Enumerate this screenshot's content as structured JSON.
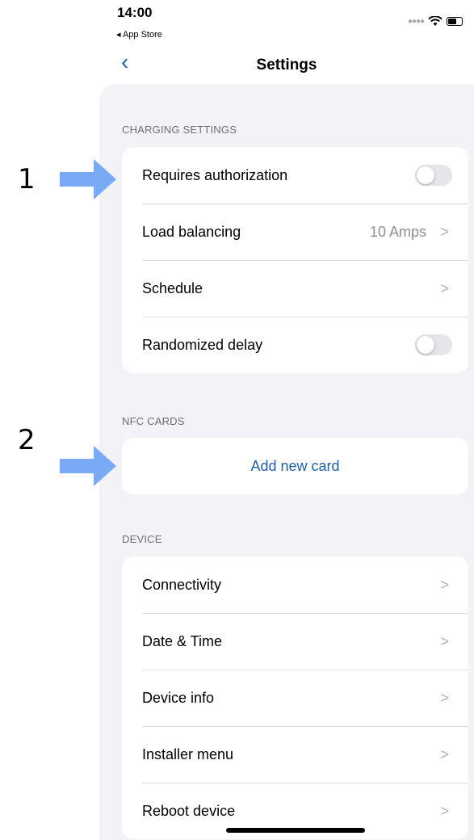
{
  "status_bar": {
    "time": "14:00",
    "back_label": "◂ App Store"
  },
  "nav": {
    "back_icon": "chevron-left-icon",
    "title": "Settings"
  },
  "sections": {
    "charging": {
      "label": "CHARGING SETTINGS",
      "rows": [
        {
          "label": "Requires authorization",
          "toggle_on": false
        },
        {
          "label": "Load balancing",
          "value": "10 Amps"
        },
        {
          "label": "Schedule"
        },
        {
          "label": "Randomized delay",
          "toggle_on": false
        }
      ]
    },
    "nfc": {
      "label": "NFC CARDS",
      "add_card_label": "Add new card"
    },
    "device": {
      "label": "DEVICE",
      "rows": [
        {
          "label": "Connectivity"
        },
        {
          "label": "Date & Time"
        },
        {
          "label": "Device info"
        },
        {
          "label": "Installer menu"
        },
        {
          "label": "Reboot device"
        }
      ]
    }
  },
  "annotations": {
    "callout_1": "1",
    "callout_2": "2",
    "arrow_color": "#7aaaf5"
  },
  "colors": {
    "accent": "#1f5fa8",
    "background": "#f2f2f7"
  }
}
